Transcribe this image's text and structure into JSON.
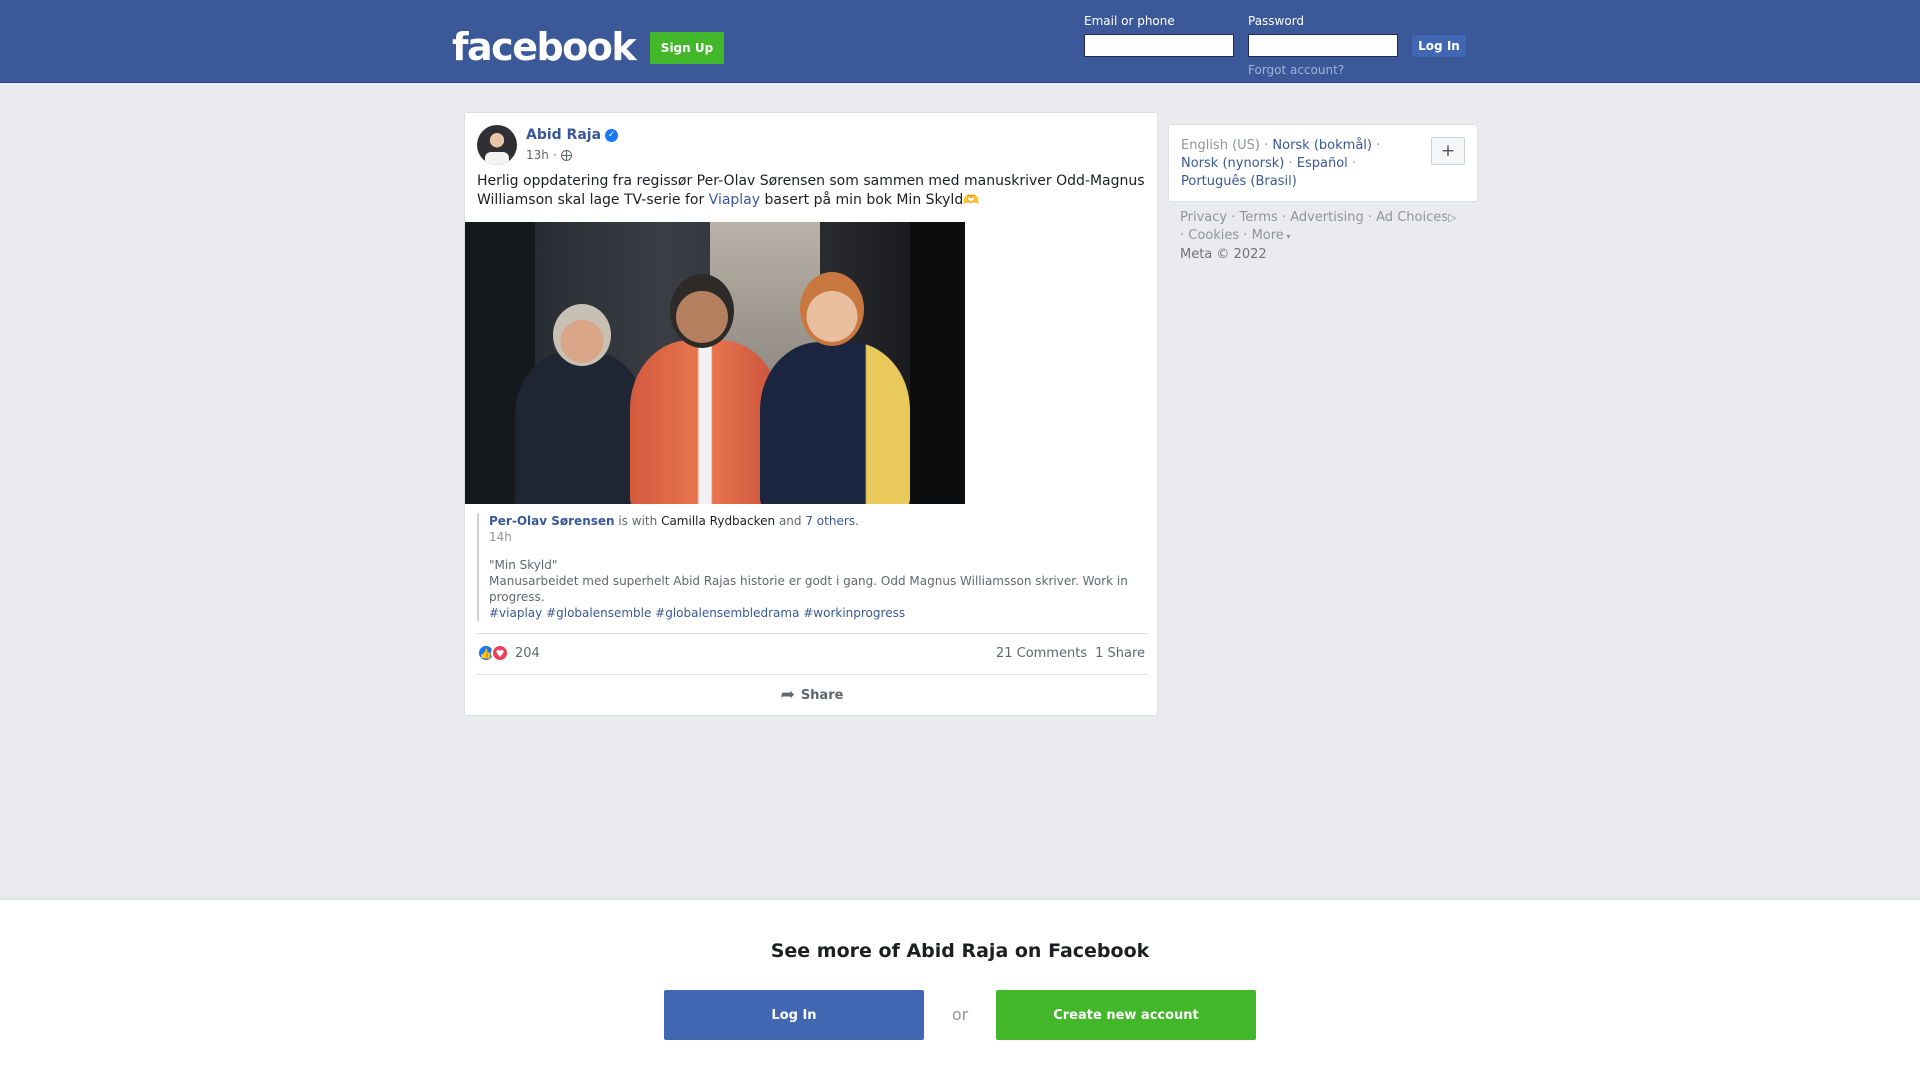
{
  "header": {
    "logo_text": "facebook",
    "signup_label": "Sign Up",
    "email_label": "Email or phone",
    "email_value": "",
    "password_label": "Password",
    "password_value": "",
    "login_label": "Log In",
    "forgot_label": "Forgot account?"
  },
  "post": {
    "author": "Abid Raja",
    "verified_glyph": "✓",
    "time": "13h",
    "separator": "·",
    "text_part1": "Herlig oppdatering fra regissør Per-Olav Sørensen som sammen med manuskriver Odd-Magnus Williamson skal lage TV-serie for ",
    "text_link": "Viaplay",
    "text_part2": " basert på min bok Min Skyld",
    "text_emoji": "🫶",
    "shared": {
      "name": "Per-Olav Sørensen",
      "is_with": " is with ",
      "with_person": "Camilla Rydbacken",
      "and": " and ",
      "others": "7 others",
      "period": ".",
      "time": "14h",
      "line1": "\"Min Skyld\"",
      "line2": "Manusarbeidet med superhelt Abid Rajas historie er godt i gang. Odd Magnus Williamsson skriver. Work in progress.",
      "hashtags": "#viaplay #globalensemble #globalensembledrama #workinprogress"
    },
    "reaction_count": "204",
    "comments": "21 Comments",
    "shares": "1 Share",
    "share_label": "Share"
  },
  "sidebar": {
    "languages": [
      {
        "label": "English (US)",
        "active": true
      },
      {
        "label": "Norsk (bokmål)",
        "active": false
      },
      {
        "label": "Norsk (nynorsk)",
        "active": false
      },
      {
        "label": "Español",
        "active": false
      },
      {
        "label": "Português (Brasil)",
        "active": false
      }
    ],
    "lang_sep": " · ",
    "plus_label": "+",
    "footer": {
      "privacy": "Privacy",
      "terms": "Terms",
      "advertising": "Advertising",
      "ad_choices": "Ad Choices",
      "cookies": "Cookies",
      "more": "More",
      "copyright": "Meta © 2022"
    }
  },
  "bottom": {
    "title": "See more of Abid Raja on Facebook",
    "login_label": "Log In",
    "or_label": "or",
    "create_label": "Create new account"
  },
  "icons": {
    "globe": "globe-icon",
    "verified": "verified-badge-icon",
    "like": "like-reaction-icon",
    "love": "love-reaction-icon",
    "share": "share-arrow-icon",
    "plus": "plus-icon",
    "adchoices": "ad-choices-icon"
  },
  "colors": {
    "brand_blue": "#3b5998",
    "link_blue": "#385898",
    "button_blue": "#4267b2",
    "signup_green": "#42b72a"
  }
}
